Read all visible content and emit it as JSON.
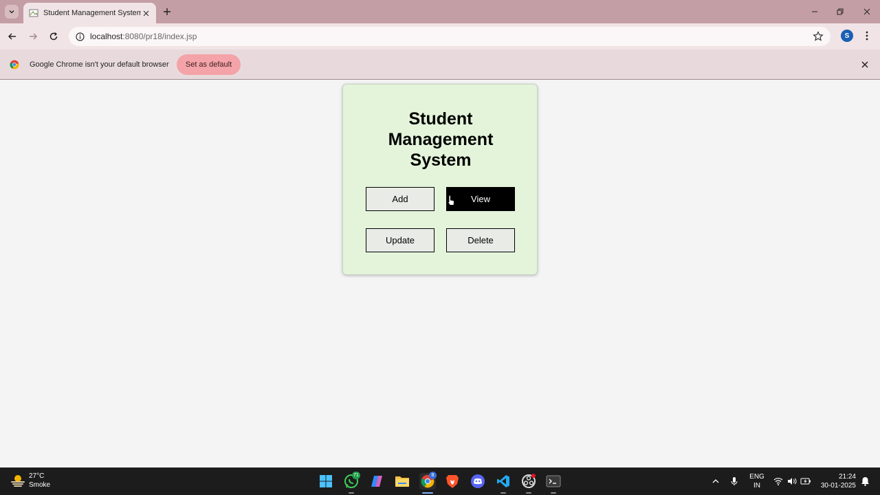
{
  "browser": {
    "tab_title": "Student Management System",
    "url_host": "localhost",
    "url_rest": ":8080/pr18/index.jsp",
    "profile_initial": "S"
  },
  "infobar": {
    "message": "Google Chrome isn't your default browser",
    "button_label": "Set as default"
  },
  "page": {
    "title_lines": [
      "Student",
      "Management",
      "System"
    ],
    "buttons": {
      "add": "Add",
      "view": "View",
      "update": "Update",
      "delete": "Delete"
    }
  },
  "taskbar": {
    "weather_temp": "27°C",
    "weather_desc": "Smoke",
    "whatsapp_badge": "71",
    "chrome_badge": "8",
    "lang_line1": "ENG",
    "lang_line2": "IN",
    "time": "21:24",
    "date": "30-01-2025"
  },
  "colors": {
    "tabstrip": "#c39ea4",
    "toolbar": "#f1e4e6",
    "card": "#e3f4da",
    "set_default_button": "#f4a3a8",
    "view_button": "#000000"
  }
}
